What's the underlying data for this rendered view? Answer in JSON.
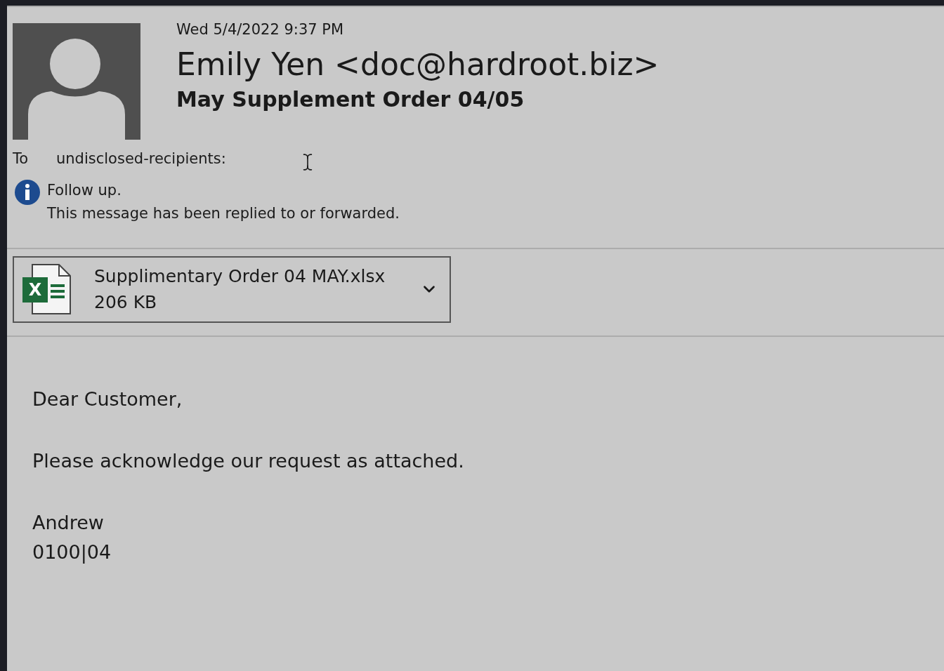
{
  "message": {
    "date": "Wed 5/4/2022 9:37 PM",
    "sender": "Emily Yen <doc@hardroot.biz>",
    "subject": "May Supplement Order 04/05",
    "to_label": "To",
    "to": "undisclosed-recipients:",
    "info": {
      "title": "Follow up.",
      "text": "This message has been replied to or forwarded."
    }
  },
  "attachment": {
    "name": "Supplimentary Order 04 MAY.xlsx",
    "size": "206 KB",
    "icon_letter": "X"
  },
  "body": [
    "Dear Customer,",
    "Please acknowledge our request as attached.",
    "Andrew",
    "0100|04"
  ]
}
